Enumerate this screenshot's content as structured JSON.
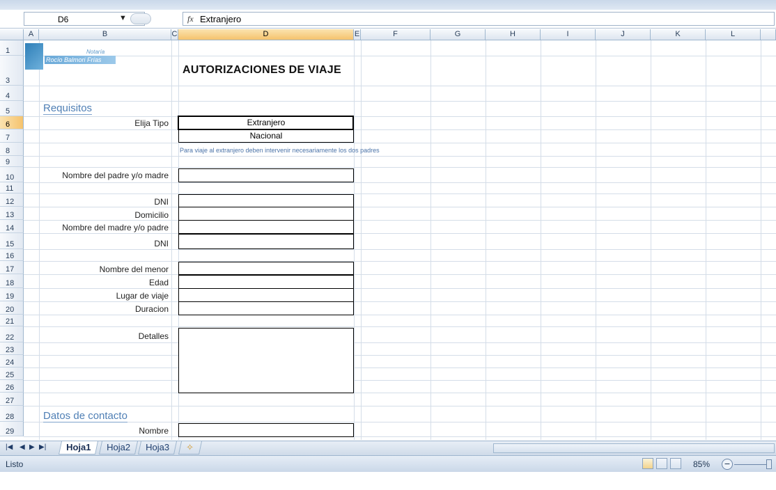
{
  "formula_bar": {
    "name_box": "D6",
    "fx_symbol": "fx",
    "formula_value": "Extranjero"
  },
  "columns": [
    "A",
    "B",
    "C",
    "D",
    "E",
    "F",
    "G",
    "H",
    "I",
    "J",
    "K",
    "L"
  ],
  "rows": [
    "1",
    "3",
    "4",
    "5",
    "6",
    "7",
    "8",
    "9",
    "10",
    "11",
    "12",
    "13",
    "14",
    "15",
    "16",
    "17",
    "18",
    "19",
    "20",
    "21",
    "22",
    "23",
    "24",
    "25",
    "26",
    "27",
    "28",
    "29"
  ],
  "logo": {
    "top_text": "Notaría",
    "main_text": "Rocío Balmori Frías"
  },
  "sheet": {
    "title": "AUTORIZACIONES DE VIAJE",
    "section_requisitos": "Requisitos",
    "elija_tipo": "Elija Tipo",
    "option_extranjero": "Extranjero",
    "option_nacional": "Nacional",
    "note": "Para viaje al extranjero deben intervenir necesariamente los dos padres",
    "fields": {
      "padre": "Nombre del padre y/o madre",
      "dni1": "DNI",
      "domicilio": "Domicilio",
      "madre": "Nombre del madre y/o padre",
      "dni2": "DNI",
      "menor": "Nombre del menor",
      "edad": "Edad",
      "lugar": "Lugar de viaje",
      "duracion": "Duracion",
      "detalles": "Detalles"
    },
    "section_contacto": "Datos de contacto",
    "nombre": "Nombre"
  },
  "tabs": [
    "Hoja1",
    "Hoja2",
    "Hoja3"
  ],
  "status": {
    "ready": "Listo",
    "zoom": "85%"
  }
}
